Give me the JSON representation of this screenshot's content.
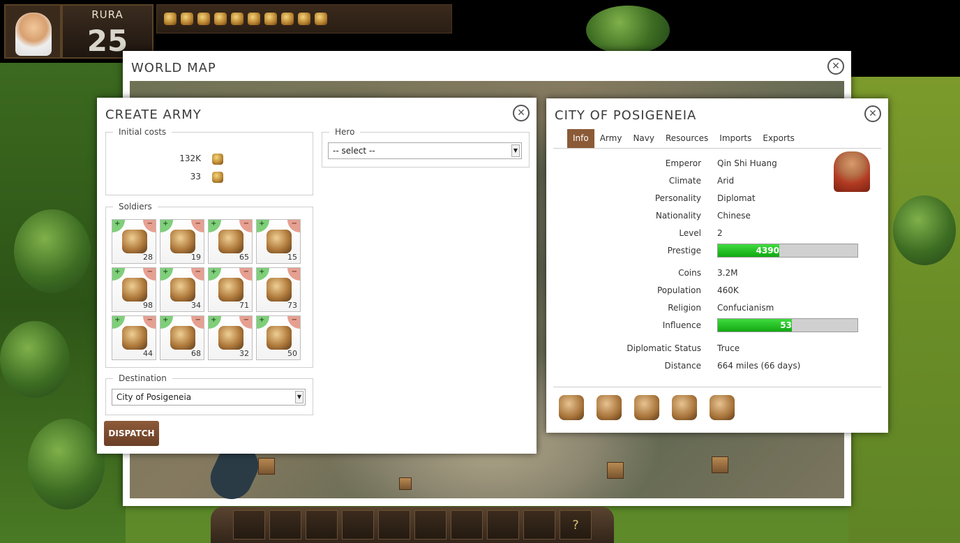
{
  "hud": {
    "player_name": "RURA",
    "level": "25",
    "resource_icons": [
      "gold-icon",
      "wood-icon",
      "stone-icon",
      "tools-icon",
      "bread-icon",
      "meat-icon",
      "cloth-icon",
      "weapons-icon",
      "hammer-icon",
      "ingot-icon"
    ]
  },
  "world_map": {
    "title": "WORLD MAP"
  },
  "create_army": {
    "title": "CREATE ARMY",
    "initial_costs": {
      "legend": "Initial costs",
      "items": [
        {
          "value": "132K",
          "icon": "coins-icon"
        },
        {
          "value": "33",
          "icon": "food-sack-icon"
        }
      ]
    },
    "hero": {
      "legend": "Hero",
      "selected": "-- select --"
    },
    "soldiers": {
      "legend": "Soldiers",
      "plus_label": "+",
      "minus_label": "−",
      "units": [
        {
          "icon": "hammer-icon",
          "count": "28"
        },
        {
          "icon": "sword-icon",
          "count": "19"
        },
        {
          "icon": "axe-icon",
          "count": "65"
        },
        {
          "icon": "crossbow-icon",
          "count": "15"
        },
        {
          "icon": "helmet-icon",
          "count": "98"
        },
        {
          "icon": "crossed-swords-icon",
          "count": "34"
        },
        {
          "icon": "round-shield-icon",
          "count": "71"
        },
        {
          "icon": "kite-shield-icon",
          "count": "73"
        },
        {
          "icon": "warhammer-icon",
          "count": "44"
        },
        {
          "icon": "cannon-icon",
          "count": "68"
        },
        {
          "icon": "siege-ram-icon",
          "count": "32"
        },
        {
          "icon": "catapult-icon",
          "count": "50"
        }
      ]
    },
    "destination": {
      "legend": "Destination",
      "selected": "City of Posigeneia"
    },
    "dispatch_label": "DISPATCH"
  },
  "city": {
    "title": "CITY OF POSIGENEIA",
    "tabs": [
      "Info",
      "Army",
      "Navy",
      "Resources",
      "Imports",
      "Exports"
    ],
    "active_tab": "Info",
    "rows": [
      {
        "label": "Emperor",
        "value": "Qin Shi Huang"
      },
      {
        "label": "Climate",
        "value": "Arid"
      },
      {
        "label": "Personality",
        "value": "Diplomat"
      },
      {
        "label": "Nationality",
        "value": "Chinese"
      },
      {
        "label": "Level",
        "value": "2"
      }
    ],
    "prestige": {
      "label": "Prestige",
      "value": "4390",
      "fraction": 0.44
    },
    "rows2": [
      {
        "label": "Coins",
        "value": "3.2M"
      },
      {
        "label": "Population",
        "value": "460K"
      },
      {
        "label": "Religion",
        "value": "Confucianism"
      }
    ],
    "influence": {
      "label": "Influence",
      "value": "53",
      "fraction": 0.53
    },
    "rows3": [
      {
        "label": "Diplomatic Status",
        "value": "Truce"
      },
      {
        "label": "Distance",
        "value": "664 miles (66 days)"
      }
    ],
    "actions": [
      "attack-icon",
      "caravan-icon",
      "spy-icon",
      "diplomacy-icon",
      "fist-icon"
    ]
  },
  "bottom_bar": {
    "help_label": "?"
  }
}
